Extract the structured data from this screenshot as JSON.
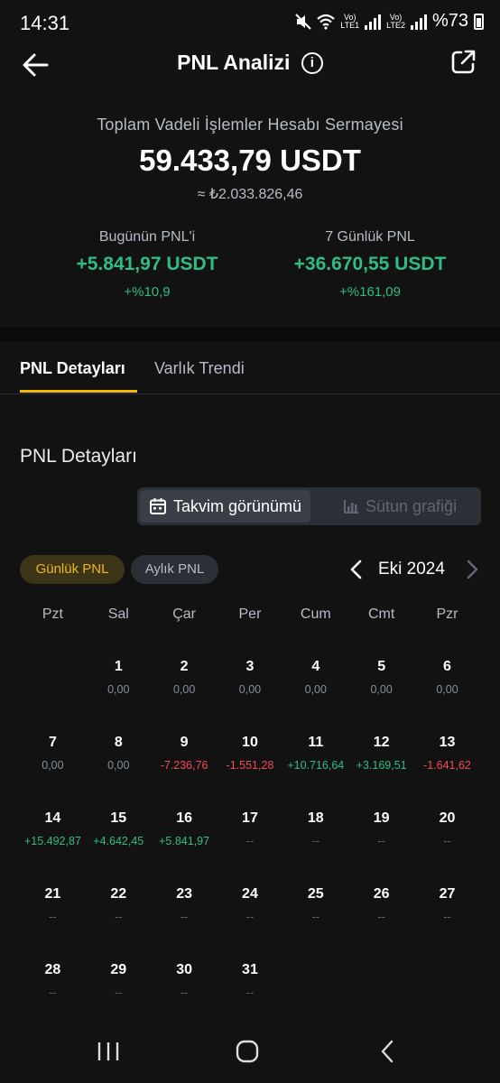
{
  "status_bar": {
    "time": "14:31",
    "sim1": "LTE1",
    "sim2": "LTE2",
    "battery": "%73"
  },
  "header": {
    "title": "PNL Analizi",
    "info_glyph": "i"
  },
  "summary": {
    "label": "Toplam Vadeli İşlemler Hesabı Sermayesi",
    "value": "59.433,79 USDT",
    "approx": "≈ ₺2.033.826,46",
    "today": {
      "label": "Bugünün PNL'i",
      "value": "+5.841,97 USDT",
      "percent": "+%10,9"
    },
    "week": {
      "label": "7 Günlük PNL",
      "value": "+36.670,55 USDT",
      "percent": "+%161,09"
    }
  },
  "tabs": [
    {
      "label": "PNL Detayları",
      "active": true
    },
    {
      "label": "Varlık Trendi",
      "active": false
    }
  ],
  "section": {
    "title": "PNL Detayları",
    "view_calendar": "Takvim görünümü",
    "view_bar": "Sütun grafiği"
  },
  "filters": {
    "daily": "Günlük PNL",
    "monthly": "Aylık PNL"
  },
  "month": "Eki 2024",
  "weekdays": [
    "Pzt",
    "Sal",
    "Çar",
    "Per",
    "Cum",
    "Cmt",
    "Pzr"
  ],
  "calendar": [
    [
      null,
      {
        "day": "1",
        "value": "0,00",
        "tone": "zero"
      },
      {
        "day": "2",
        "value": "0,00",
        "tone": "zero"
      },
      {
        "day": "3",
        "value": "0,00",
        "tone": "zero"
      },
      {
        "day": "4",
        "value": "0,00",
        "tone": "zero"
      },
      {
        "day": "5",
        "value": "0,00",
        "tone": "zero"
      },
      {
        "day": "6",
        "value": "0,00",
        "tone": "zero"
      }
    ],
    [
      {
        "day": "7",
        "value": "0,00",
        "tone": "zero"
      },
      {
        "day": "8",
        "value": "0,00",
        "tone": "zero"
      },
      {
        "day": "9",
        "value": "-7.236,76",
        "tone": "neg"
      },
      {
        "day": "10",
        "value": "-1.551,28",
        "tone": "neg"
      },
      {
        "day": "11",
        "value": "+10.716,64",
        "tone": "pos"
      },
      {
        "day": "12",
        "value": "+3.169,51",
        "tone": "pos"
      },
      {
        "day": "13",
        "value": "-1.641,62",
        "tone": "neg"
      }
    ],
    [
      {
        "day": "14",
        "value": "+15.492,87",
        "tone": "pos"
      },
      {
        "day": "15",
        "value": "+4.642,45",
        "tone": "pos"
      },
      {
        "day": "16",
        "value": "+5.841,97",
        "tone": "pos"
      },
      {
        "day": "17",
        "value": "--",
        "tone": "none"
      },
      {
        "day": "18",
        "value": "--",
        "tone": "none"
      },
      {
        "day": "19",
        "value": "--",
        "tone": "none"
      },
      {
        "day": "20",
        "value": "--",
        "tone": "none"
      }
    ],
    [
      {
        "day": "21",
        "value": "--",
        "tone": "none"
      },
      {
        "day": "22",
        "value": "--",
        "tone": "none"
      },
      {
        "day": "23",
        "value": "--",
        "tone": "none"
      },
      {
        "day": "24",
        "value": "--",
        "tone": "none"
      },
      {
        "day": "25",
        "value": "--",
        "tone": "none"
      },
      {
        "day": "26",
        "value": "--",
        "tone": "none"
      },
      {
        "day": "27",
        "value": "--",
        "tone": "none"
      }
    ],
    [
      {
        "day": "28",
        "value": "--",
        "tone": "none"
      },
      {
        "day": "29",
        "value": "--",
        "tone": "none"
      },
      {
        "day": "30",
        "value": "--",
        "tone": "none"
      },
      {
        "day": "31",
        "value": "--",
        "tone": "none"
      },
      null,
      null,
      null
    ]
  ],
  "colors": {
    "background": "#121212",
    "accent": "#f0b90b",
    "positive": "#2ebd85",
    "negative": "#f6465d"
  },
  "icons": [
    "mute-icon",
    "wifi-icon",
    "signal-icon",
    "battery-icon",
    "back-arrow-icon",
    "info-icon",
    "share-icon",
    "calendar-icon",
    "bar-chart-icon",
    "chevron-left-icon",
    "chevron-right-icon",
    "recents-icon",
    "home-icon",
    "back-icon"
  ]
}
